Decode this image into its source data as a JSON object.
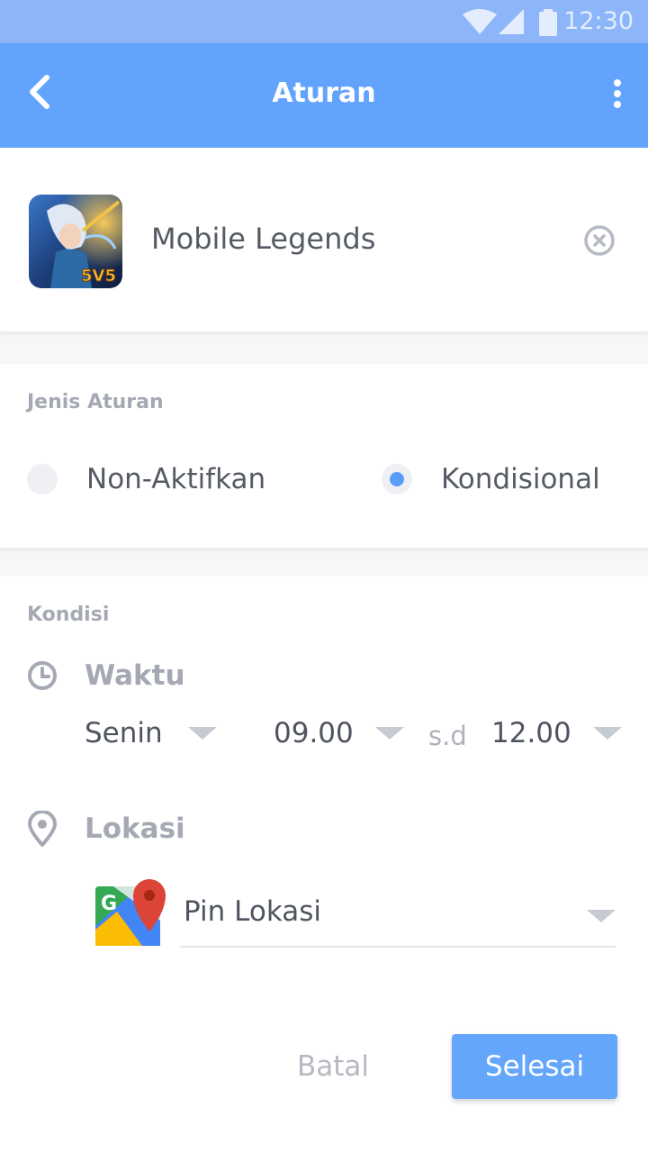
{
  "status_bar": {
    "time": "12:30"
  },
  "header": {
    "title": "Aturan"
  },
  "app": {
    "name": "Mobile Legends",
    "icon_badge": "5V5"
  },
  "rule_type": {
    "section_label": "Jenis Aturan",
    "options": [
      {
        "label": "Non-Aktifkan",
        "selected": false
      },
      {
        "label": "Kondisional",
        "selected": true
      }
    ]
  },
  "condition": {
    "section_label": "Kondisi",
    "time": {
      "label": "Waktu",
      "day": "Senin",
      "start": "09.00",
      "separator": "s.d",
      "end": "12.00"
    },
    "location": {
      "label": "Lokasi",
      "value": "Pin Lokasi"
    }
  },
  "actions": {
    "cancel": "Batal",
    "done": "Selesai"
  },
  "colors": {
    "primary": "#62a3fd",
    "status_bar": "#8db6fa",
    "selected_dot": "#5a9cf8"
  }
}
